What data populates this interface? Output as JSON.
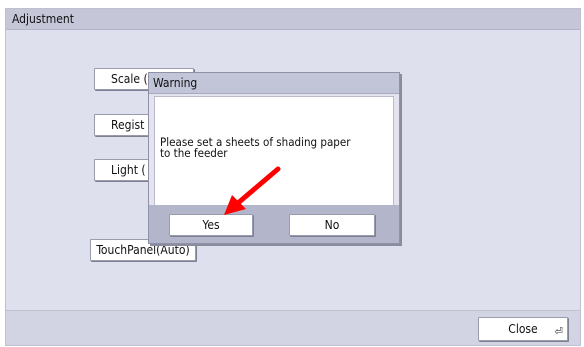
{
  "window": {
    "title": "Adjustment"
  },
  "main_buttons": {
    "scale": "Scale (",
    "regist": "Regist",
    "light": "Light (",
    "touchpanel": "TouchPanel(Auto)"
  },
  "footer": {
    "close_label": "Close"
  },
  "dialog": {
    "title": "Warning",
    "message_line1": "Please set a sheets of shading paper",
    "message_line2": "to the feeder",
    "yes_label": "Yes",
    "no_label": "No"
  },
  "colors": {
    "annotation_arrow": "#ff0000"
  },
  "icons": {
    "enter": "enter-return-icon",
    "arrow": "red-annotation-arrow"
  }
}
